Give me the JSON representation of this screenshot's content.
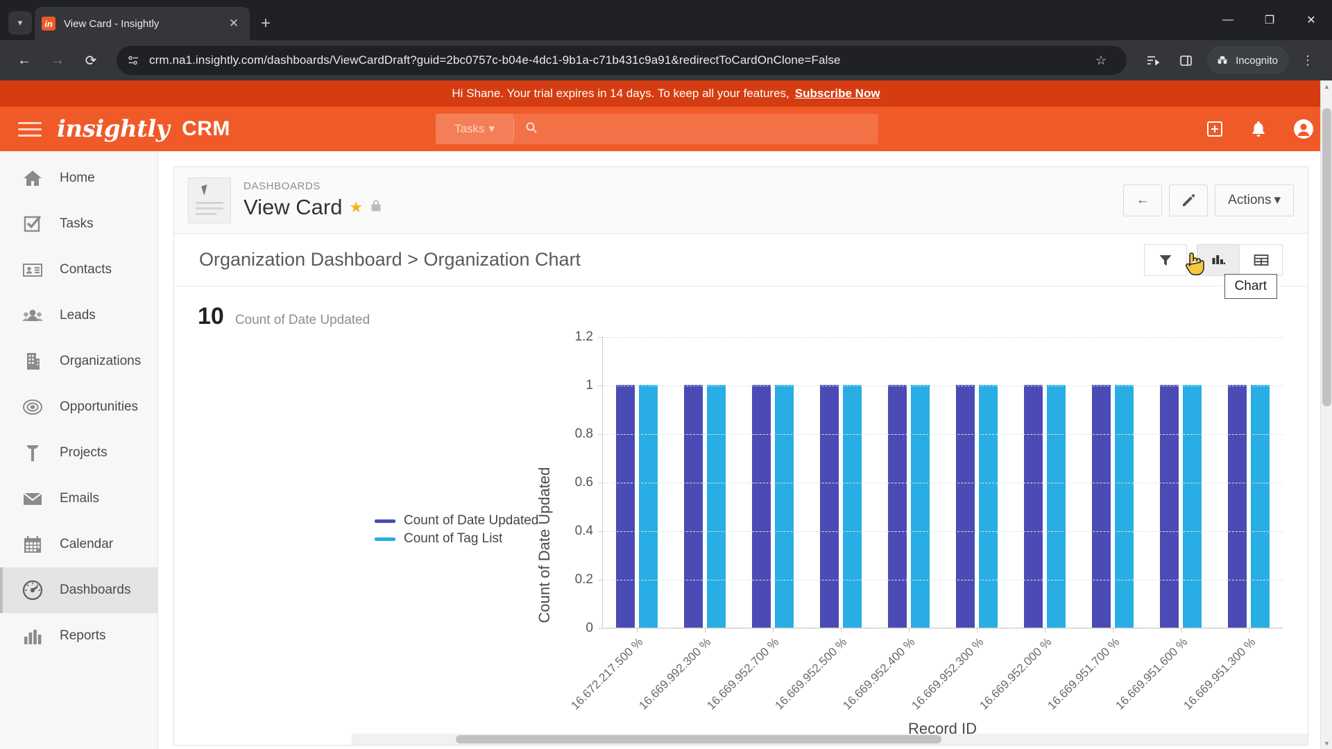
{
  "browser": {
    "tab": {
      "title": "View Card - Insightly",
      "favicon_text": "in"
    },
    "new_tab_label": "+",
    "tab_close_label": "✕",
    "window": {
      "minimize": "—",
      "maximize": "❐",
      "close": "✕"
    },
    "nav": {
      "back": "←",
      "forward": "→",
      "reload": "⟳"
    },
    "url": "crm.na1.insightly.com/dashboards/ViewCardDraft?guid=2bc0757c-b04e-4dc1-9b1a-c71b431c9a91&redirectToCardOnClone=False",
    "bookmark_icon": "☆",
    "incognito_label": "Incognito",
    "menu_icon": "⋮"
  },
  "banner": {
    "message": "Hi Shane. Your trial expires in 14 days. To keep all your features,",
    "link": "Subscribe Now"
  },
  "appheader": {
    "brand": "insightly",
    "product": "CRM",
    "search_scope": "Tasks",
    "search_placeholder": "",
    "search_value": "",
    "add_icon": "+",
    "bell_icon": "●",
    "avatar_icon": "●"
  },
  "sidebar": {
    "items": [
      {
        "label": "Home",
        "icon": "home-icon",
        "active": false
      },
      {
        "label": "Tasks",
        "icon": "tasks-icon",
        "active": false
      },
      {
        "label": "Contacts",
        "icon": "contacts-icon",
        "active": false
      },
      {
        "label": "Leads",
        "icon": "leads-icon",
        "active": false
      },
      {
        "label": "Organizations",
        "icon": "organizations-icon",
        "active": false
      },
      {
        "label": "Opportunities",
        "icon": "opportunities-icon",
        "active": false
      },
      {
        "label": "Projects",
        "icon": "projects-icon",
        "active": false
      },
      {
        "label": "Emails",
        "icon": "emails-icon",
        "active": false
      },
      {
        "label": "Calendar",
        "icon": "calendar-icon",
        "active": false
      },
      {
        "label": "Dashboards",
        "icon": "dashboards-icon",
        "active": true
      },
      {
        "label": "Reports",
        "icon": "reports-icon",
        "active": false
      }
    ]
  },
  "card": {
    "eyebrow": "DASHBOARDS",
    "title": "View Card",
    "star_icon": "★",
    "lock_icon": "🔒",
    "back_button": "←",
    "edit_button": "✎",
    "actions_button": "Actions",
    "actions_caret": "▾"
  },
  "cardsub": {
    "breadcrumb": "Organization Dashboard > Organization Chart",
    "filter_label": "filter-icon",
    "chart_label": "chart-icon",
    "table_label": "table-icon",
    "tooltip": "Chart"
  },
  "metric": {
    "value": "10",
    "label": "Count of Date Updated"
  },
  "chart_data": {
    "type": "bar",
    "title": "",
    "xlabel": "Record ID",
    "ylabel": "Count of Date Updated",
    "ylim": [
      0,
      1.2
    ],
    "yticks": [
      0,
      0.2,
      0.4,
      0.6,
      0.8,
      1,
      1.2
    ],
    "ytick_labels": [
      "0",
      "0.2",
      "0.4",
      "0.6",
      "0.8",
      "1",
      "1.2"
    ],
    "grid": true,
    "legend_position": "left",
    "categories": [
      "16.672.217.500 %",
      "16.669.992.300 %",
      "16.669.952.700 %",
      "16.669.952.500 %",
      "16.669.952.400 %",
      "16.669.952.300 %",
      "16.669.952.000 %",
      "16.669.951.700 %",
      "16.669.951.600 %",
      "16.669.951.300 %"
    ],
    "series": [
      {
        "name": "Count of Date Updated",
        "color": "#4b4bb5",
        "values": [
          1,
          1,
          1,
          1,
          1,
          1,
          1,
          1,
          1,
          1
        ]
      },
      {
        "name": "Count of Tag List",
        "color": "#28aee4",
        "values": [
          1,
          1,
          1,
          1,
          1,
          1,
          1,
          1,
          1,
          1
        ]
      }
    ]
  }
}
